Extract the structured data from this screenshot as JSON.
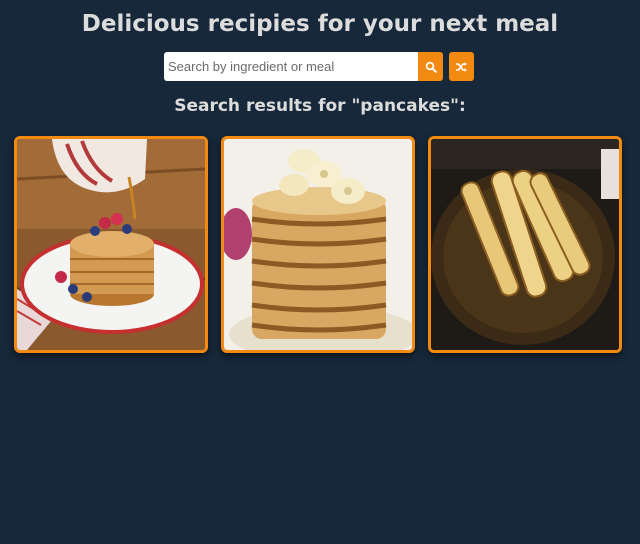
{
  "header": {
    "title": "Delicious recipies for your next meal"
  },
  "search": {
    "placeholder": "Search by ingredient or meal",
    "value": "",
    "search_button_icon": "search-icon",
    "random_button_icon": "shuffle-icon"
  },
  "results": {
    "heading": "Search results for \"pancakes\":",
    "meals": [
      {
        "thumbnail": "pancake stack with berries and syrup"
      },
      {
        "thumbnail": "tall pancake stack topped with banana slices"
      },
      {
        "thumbnail": "rolled pancakes on a dark plate"
      }
    ]
  },
  "colors": {
    "background": "#16283a",
    "accent": "#f28a12",
    "heading_text": "#dcdcdc"
  }
}
